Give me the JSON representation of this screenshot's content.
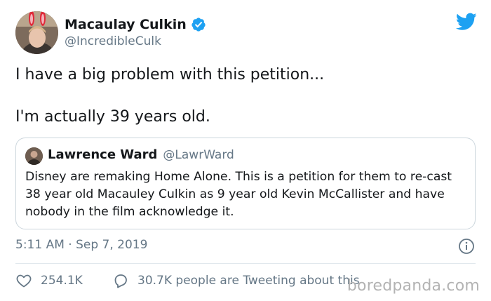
{
  "author": {
    "display_name": "Macaulay Culkin",
    "handle": "@IncredibleCulk",
    "verified": true,
    "avatar_icon": "user-avatar-photo"
  },
  "platform": {
    "logo_icon": "twitter-bird-icon",
    "brand_color": "#1da1f2"
  },
  "tweet": {
    "lines": [
      "I have a big problem with this petition...",
      "I'm actually 39 years old."
    ]
  },
  "quoted_tweet": {
    "display_name": "Lawrence Ward",
    "handle": "@LawrWard",
    "text": "Disney are remaking Home Alone. This is a petition for them to re-cast 38 year old Macauley Culkin as 9 year old Kevin McCallister and have nobody in the film acknowledge it."
  },
  "meta": {
    "timestamp": "5:11 AM · Sep 7, 2019"
  },
  "actions": {
    "likes": "254.1K",
    "retweets_text": "30.7K people are Tweeting about this"
  },
  "watermark": {
    "text": "boredpanda.com"
  },
  "colors": {
    "text_primary": "#14171a",
    "text_secondary": "#657786",
    "border": "#ccd6dd",
    "verified_badge": "#1da1f2"
  }
}
